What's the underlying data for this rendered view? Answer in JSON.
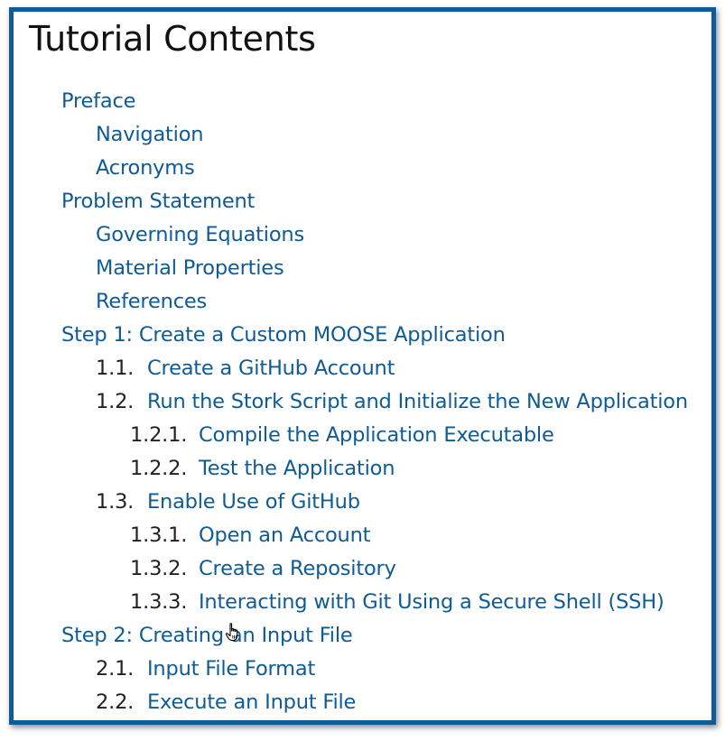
{
  "title": "Tutorial Contents",
  "toc": {
    "items": [
      {
        "num": "",
        "label": "Preface"
      },
      {
        "num": "",
        "label": "Navigation"
      },
      {
        "num": "",
        "label": "Acronyms"
      },
      {
        "num": "",
        "label": "Problem Statement"
      },
      {
        "num": "",
        "label": "Governing Equations"
      },
      {
        "num": "",
        "label": "Material Properties"
      },
      {
        "num": "",
        "label": "References"
      },
      {
        "num": "",
        "label": "Step 1: Create a Custom MOOSE Application"
      },
      {
        "num": "1.1.",
        "label": "Create a GitHub Account"
      },
      {
        "num": "1.2.",
        "label": "Run the Stork Script and Initialize the New Application"
      },
      {
        "num": "1.2.1.",
        "label": "Compile the Application Executable"
      },
      {
        "num": "1.2.2.",
        "label": "Test the Application"
      },
      {
        "num": "1.3.",
        "label": "Enable Use of GitHub"
      },
      {
        "num": "1.3.1.",
        "label": "Open an Account"
      },
      {
        "num": "1.3.2.",
        "label": "Create a Repository"
      },
      {
        "num": "1.3.3.",
        "label": "Interacting with Git Using a Secure Shell (SSH)"
      },
      {
        "num": "",
        "label": "Step 2: Creating an Input File"
      },
      {
        "num": "2.1.",
        "label": "Input File Format"
      },
      {
        "num": "2.2.",
        "label": "Execute an Input File"
      }
    ]
  },
  "colors": {
    "link": "#0e5b96",
    "border": "#0e5b96",
    "number": "#222222",
    "title": "#111111"
  },
  "cursor_icon": "hand-pointer-icon"
}
